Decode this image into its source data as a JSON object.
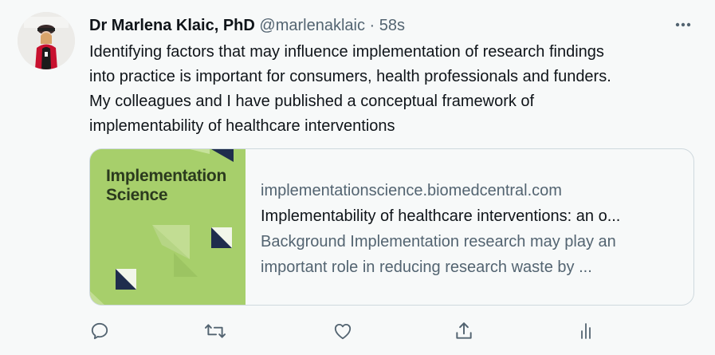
{
  "tweet": {
    "author_name": "Dr Marlena Klaic, PhD",
    "handle": "@marlenaklaic",
    "separator": "·",
    "time": "58s",
    "text_lines": [
      "Identifying factors that may influence implementation of research findings",
      "into practice is important for consumers, health professionals and funders.",
      "My colleagues and I have published a conceptual framework of",
      "implementability of healthcare interventions"
    ]
  },
  "card": {
    "thumbnail_line1": "Implementation",
    "thumbnail_line2": "Science",
    "domain": "implementationscience.biomedcentral.com",
    "title": "Implementability of healthcare interventions: an o...",
    "description_lines": [
      "Background Implementation research may play an",
      "important role in reducing research waste by ..."
    ]
  },
  "actions": [
    {
      "icon": "reply-icon"
    },
    {
      "icon": "retweet-icon"
    },
    {
      "icon": "like-icon"
    },
    {
      "icon": "share-icon"
    },
    {
      "icon": "analytics-icon"
    }
  ],
  "colors": {
    "background": "#f7f9f9",
    "text": "#0f1419",
    "secondary_text": "#536471",
    "border": "#cfd9de",
    "thumbnail_green": "#a7cf6b",
    "thumbnail_navy": "#1f2d4d"
  }
}
